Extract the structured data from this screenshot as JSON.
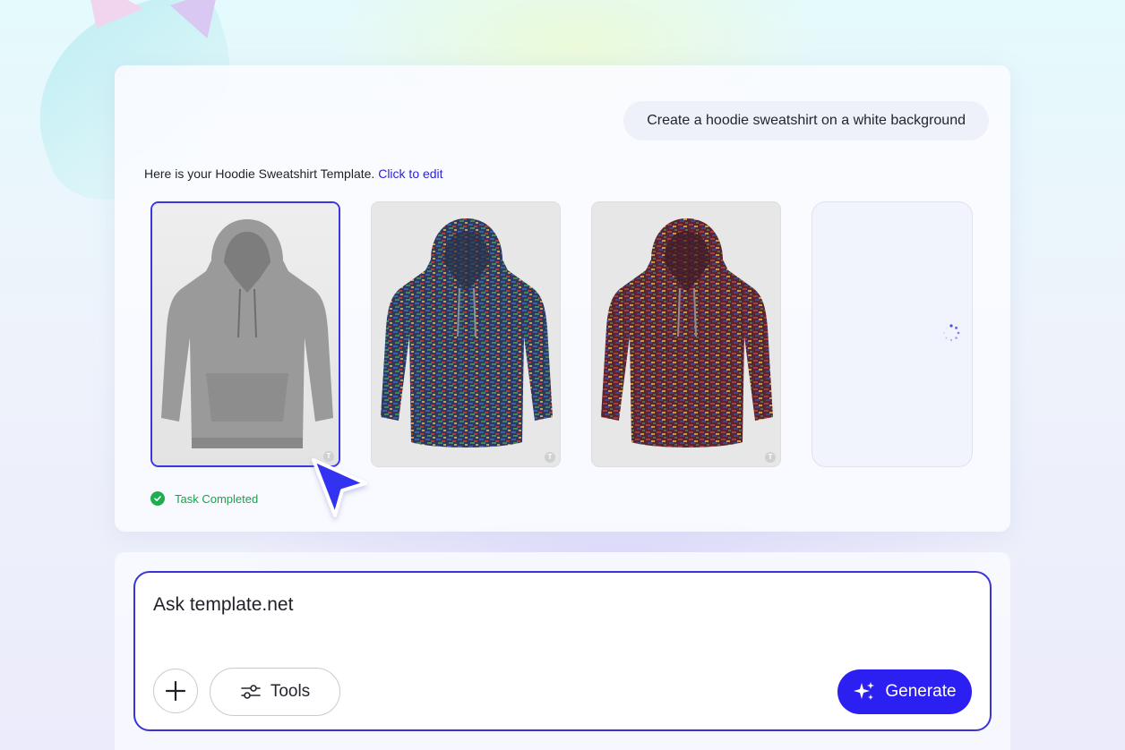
{
  "chat": {
    "user_message": "Create a hoodie sweatshirt on a white background",
    "response_text": "Here is your Hoodie Sweatshirt Template.",
    "response_link": "Click to edit",
    "status_text": "Task Completed"
  },
  "thumbnails": [
    {
      "label": "gray-hoodie",
      "badge": "T",
      "selected": true
    },
    {
      "label": "multicolor-blue-hoodie",
      "badge": "T",
      "selected": false
    },
    {
      "label": "multicolor-red-hoodie",
      "badge": "T",
      "selected": false
    },
    {
      "label": "loading-placeholder",
      "state": "loading"
    }
  ],
  "composer": {
    "placeholder": "Ask template.net",
    "tools_label": "Tools",
    "generate_label": "Generate"
  },
  "icons": {
    "plus": "plus-icon",
    "tools": "sliders-icon",
    "generate": "sparkle-icon",
    "status": "check-circle-icon",
    "cursor": "pointer-cursor-icon",
    "loading": "spinner-icon"
  },
  "colors": {
    "accent": "#2b1ff2",
    "link": "#2d23d8",
    "success": "#1fae4f",
    "selected_border": "#3b37e0"
  }
}
